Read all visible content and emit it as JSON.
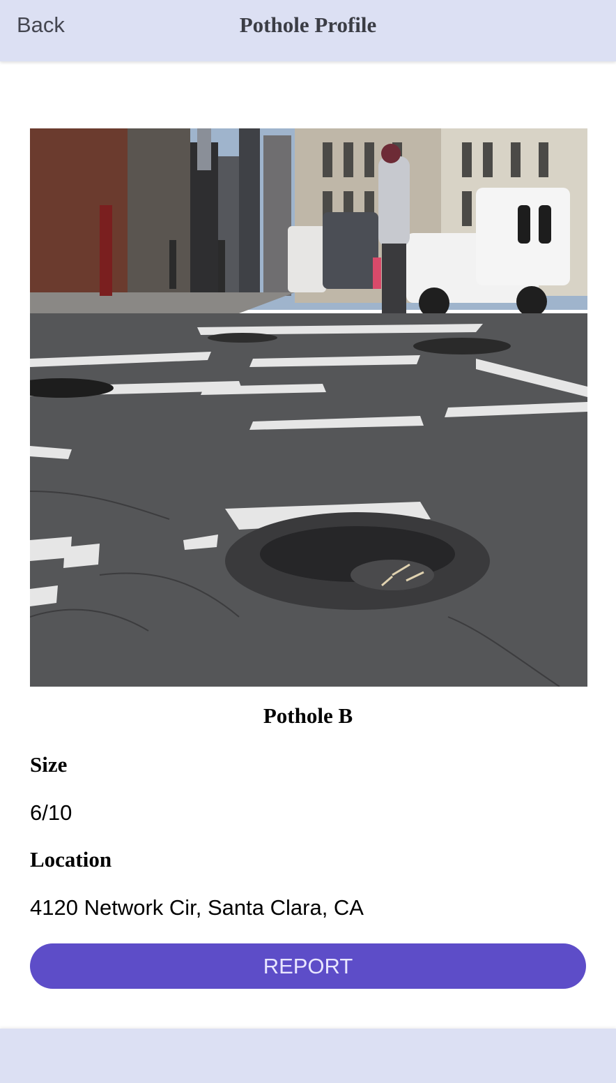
{
  "header": {
    "back_label": "Back",
    "title": "Pothole Profile"
  },
  "pothole": {
    "name": "Pothole B",
    "size_label": "Size",
    "size_value": "6/10",
    "location_label": "Location",
    "location_value": "4120 Network Cir, Santa Clara, CA"
  },
  "actions": {
    "report_label": "REPORT"
  },
  "colors": {
    "header_bg": "#dce0f3",
    "accent": "#5d4dc8"
  }
}
